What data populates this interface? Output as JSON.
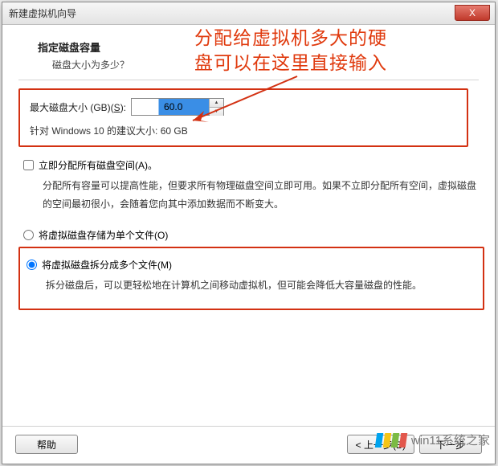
{
  "window": {
    "title": "新建虚拟机向导",
    "close_glyph": "X"
  },
  "header": {
    "title": "指定磁盘容量",
    "subtitle": "磁盘大小为多少？"
  },
  "annotation": {
    "line1": "分配给虚拟机多大的硬",
    "line2": "盘可以在这里直接输入"
  },
  "size": {
    "label_prefix": "最大磁盘大小 (GB)(",
    "mnemonic": "S",
    "label_suffix": "):",
    "value": "60.0",
    "recommend": "针对 Windows 10 的建议大小: 60 GB"
  },
  "alloc": {
    "checkbox_prefix": "立即分配所有磁盘空间(",
    "checkbox_mnemonic": "A",
    "checkbox_suffix": ")。",
    "desc": "分配所有容量可以提高性能，但要求所有物理磁盘空间立即可用。如果不立即分配所有空间，虚拟磁盘的空间最初很小，会随着您向其中添加数据而不断变大。"
  },
  "store": {
    "single_prefix": "将虚拟磁盘存储为单个文件(",
    "single_mnemonic": "O",
    "single_suffix": ")",
    "split_prefix": "将虚拟磁盘拆分成多个文件(",
    "split_mnemonic": "M",
    "split_suffix": ")",
    "split_desc": "拆分磁盘后，可以更轻松地在计算机之间移动虚拟机，但可能会降低大容量磁盘的性能。"
  },
  "buttons": {
    "help": "帮助",
    "back": "< 上一步(B)",
    "next": "下一步"
  },
  "watermark": {
    "text": "win11系统之家"
  },
  "colors": {
    "annotation": "#e03a0e",
    "box": "#d33112"
  }
}
